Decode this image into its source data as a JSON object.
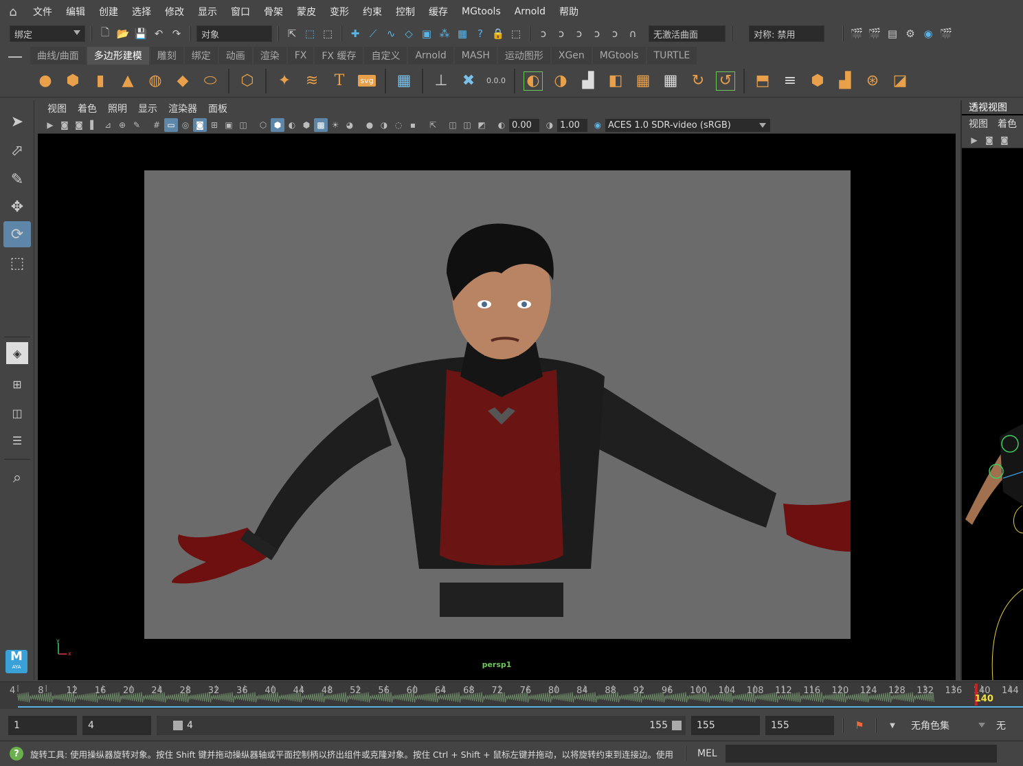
{
  "menubar": {
    "items": [
      "文件",
      "编辑",
      "创建",
      "选择",
      "修改",
      "显示",
      "窗口",
      "骨架",
      "蒙皮",
      "变形",
      "约束",
      "控制",
      "缓存",
      "MGtools",
      "Arnold",
      "帮助"
    ]
  },
  "statusline": {
    "menuset": "绑定",
    "selection_mode": "对象",
    "live_surface": "无激活曲面",
    "symmetry": "对称: 禁用"
  },
  "shelf": {
    "tabs": [
      "曲线/曲面",
      "多边形建模",
      "雕刻",
      "绑定",
      "动画",
      "渲染",
      "FX",
      "FX 缓存",
      "自定义",
      "Arnold",
      "MASH",
      "运动图形",
      "XGen",
      "MGtools",
      "TURTLE"
    ],
    "active_tab": "多边形建模",
    "svg_label": "svg",
    "text_label": "T",
    "snap_value": "0.0.0"
  },
  "panel": {
    "menu": [
      "视图",
      "着色",
      "照明",
      "显示",
      "渲染器",
      "面板"
    ],
    "exposure": "0.00",
    "gamma": "1.00",
    "colorspace": "ACES 1.0 SDR-video (sRGB)",
    "camera": "persp1",
    "axis_y": "y",
    "axis_x": "x"
  },
  "right_panel": {
    "title": "透视视图",
    "menu": [
      "视图",
      "着色"
    ]
  },
  "timeslider": {
    "ticks": [
      "4",
      "8",
      "12",
      "16",
      "20",
      "24",
      "28",
      "32",
      "36",
      "40",
      "44",
      "48",
      "52",
      "56",
      "60",
      "64",
      "68",
      "72",
      "76",
      "80",
      "84",
      "88",
      "92",
      "96",
      "100",
      "104",
      "108",
      "112",
      "116",
      "120",
      "124",
      "128",
      "132",
      "136",
      "140",
      "144"
    ],
    "current_frame": "140"
  },
  "range": {
    "start": "1",
    "anim_start": "4",
    "slider_start": "4",
    "slider_end": "155",
    "anim_end": "155",
    "end": "155",
    "character_set": "无角色集",
    "extra": "无"
  },
  "helpline": {
    "text": "旋转工具: 使用操纵器旋转对象。按住 Shift 键并拖动操纵器轴或平面控制柄以挤出组件或克隆对象。按住 Ctrl + Shift + 鼠标左键并拖动，以将旋转约束到连接边。使用 D 或 Ir",
    "mel": "MEL"
  },
  "logo": {
    "letter": "M",
    "sub": "AYA"
  },
  "colors": {
    "accent": "#5d86a8",
    "bg": "#444444",
    "field": "#2b2b2b",
    "camera_label": "#6ec85a"
  }
}
